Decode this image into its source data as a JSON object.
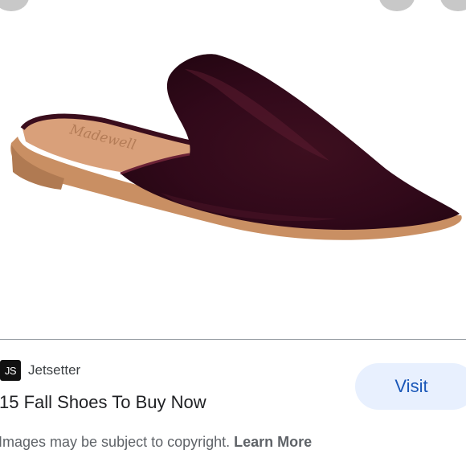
{
  "source": {
    "logo_text": "JS",
    "name": "Jetsetter"
  },
  "title": "15 Fall Shoes To Buy Now",
  "visit_button": {
    "label": "Visit"
  },
  "notice": {
    "text": "Images may be subject to copyright.",
    "link": "Learn More"
  },
  "image": {
    "brand_script": "Madewell"
  },
  "colors": {
    "velvet": "#3a0d1c",
    "sole": "#c98f63",
    "insole": "#d9a07a",
    "visit_bg": "#e8f0fe",
    "visit_text": "#1a57b8"
  }
}
